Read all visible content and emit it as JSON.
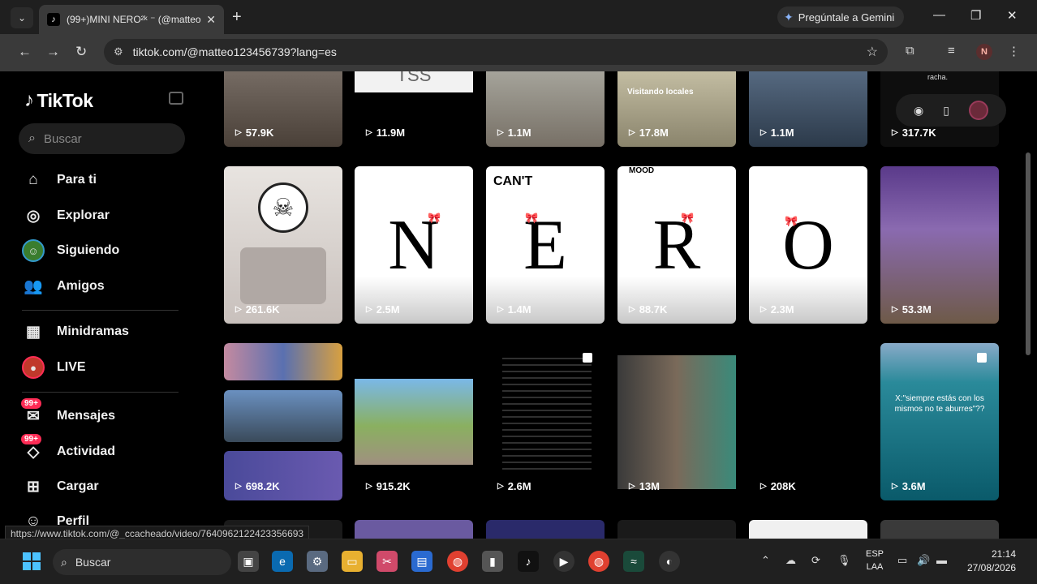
{
  "browser": {
    "tab_title": "(99+)MINI NERO²ᵏ ⁻ (@matteo",
    "gemini_label": "Pregúntale a Gemini",
    "url": "tiktok.com/@matteo123456739?lang=es",
    "status_url": "https://www.tiktok.com/@_ccacheado/video/7640962122423356693",
    "profile_initial": "N"
  },
  "sidebar": {
    "logo": "TikTok",
    "search_placeholder": "Buscar",
    "items": [
      {
        "label": "Para ti",
        "icon": "home-icon"
      },
      {
        "label": "Explorar",
        "icon": "compass-icon"
      },
      {
        "label": "Siguiendo",
        "icon": "following-avatar-icon"
      },
      {
        "label": "Amigos",
        "icon": "friends-icon"
      },
      {
        "label": "Minidramas",
        "icon": "film-icon"
      },
      {
        "label": "LIVE",
        "icon": "live-icon"
      },
      {
        "label": "Mensajes",
        "icon": "messages-icon",
        "badge": "99+"
      },
      {
        "label": "Actividad",
        "icon": "activity-icon",
        "badge": "99+"
      },
      {
        "label": "Cargar",
        "icon": "upload-icon"
      },
      {
        "label": "Perfil",
        "icon": "profile-icon"
      }
    ]
  },
  "grid": {
    "row1": [
      "57.9K",
      "11.9M",
      "1.1M",
      "17.8M",
      "1.1M",
      "317.7K"
    ],
    "row1_texts": {
      "card2": "TSS",
      "card4": "Visitando locales",
      "card6": "racha."
    },
    "row2": [
      "261.6K",
      "2.5M",
      "1.4M",
      "88.7K",
      "2.3M",
      "53.3M"
    ],
    "row2_letters": [
      "N",
      "E",
      "R",
      "O"
    ],
    "row2_texts": {
      "cant": "CAN'T",
      "mood": "MOOD"
    },
    "row3": [
      "698.2K",
      "915.2K",
      "2.6M",
      "13M",
      "208K",
      "3.6M"
    ],
    "row3_caption": "X:\"siempre estás con los mismos no te aburres\"??"
  },
  "taskbar": {
    "search_label": "Buscar",
    "lang_line1": "ESP",
    "lang_line2": "LAA",
    "time": "21:14",
    "date": "27/08/2026"
  },
  "colors": {
    "accent": "#fe2c55",
    "background": "#000000",
    "chrome_dark": "#1f1f1f",
    "chrome_toolbar": "#3a3a3a"
  }
}
